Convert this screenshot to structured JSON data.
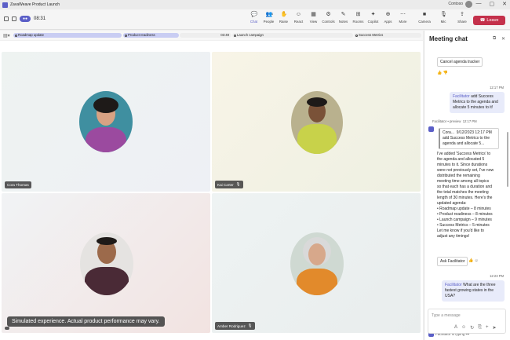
{
  "window": {
    "title": "ZavaWeave Product Launch",
    "org": "Contoso",
    "min": "—",
    "max": "▢",
    "close": "✕"
  },
  "toolbar": {
    "badge": "●●",
    "timer": "08:31",
    "tools": [
      {
        "key": "chat",
        "label": "Chat",
        "icon": "chat-icon",
        "glyph": "💬"
      },
      {
        "key": "people",
        "label": "People",
        "icon": "people-icon",
        "glyph": "👥",
        "count": "4"
      },
      {
        "key": "raise",
        "label": "Raise",
        "icon": "hand-icon",
        "glyph": "✋"
      },
      {
        "key": "react",
        "label": "React",
        "icon": "smile-icon",
        "glyph": "☺"
      },
      {
        "key": "view",
        "label": "View",
        "icon": "grid-icon",
        "glyph": "▦"
      },
      {
        "key": "controls",
        "label": "Controls",
        "icon": "controls-icon",
        "glyph": "⚙"
      },
      {
        "key": "notes",
        "label": "Notes",
        "icon": "notes-icon",
        "glyph": "✎"
      },
      {
        "key": "rooms",
        "label": "Rooms",
        "icon": "rooms-icon",
        "glyph": "⊞"
      },
      {
        "key": "copilot",
        "label": "Copilot",
        "icon": "copilot-icon",
        "glyph": "✦"
      },
      {
        "key": "apps",
        "label": "Apps",
        "icon": "apps-icon",
        "glyph": "⊕"
      },
      {
        "key": "more",
        "label": "More",
        "icon": "more-icon",
        "glyph": "⋯"
      }
    ],
    "camera": "Camera",
    "mic": "Mic",
    "share": "Share",
    "leave": "Leave"
  },
  "agenda": {
    "segments": [
      {
        "label": "Roadmap update",
        "remaining": "",
        "color": "#c9cdf3"
      },
      {
        "label": "Product readiness",
        "remaining": "",
        "color": "#c9cdf3"
      },
      {
        "label": "",
        "remaining": "03:49",
        "color": "#eeeeee"
      },
      {
        "label": "Launch campaign",
        "remaining": "",
        "color": "#eeeeee"
      },
      {
        "label": "Success Metrics",
        "remaining": "",
        "color": "#eeeeee"
      }
    ]
  },
  "participants": [
    {
      "name": "Cora Thomas",
      "muted": false
    },
    {
      "name": "Kai Carter",
      "muted": true
    },
    {
      "name": "",
      "muted": false
    },
    {
      "name": "Amber Rodriguez",
      "muted": true
    }
  ],
  "toast": "Simulated experience. Actual product performance may vary.",
  "chat": {
    "title": "Meeting chat",
    "cancel_button": "Cancel agenda tracker",
    "msg1": {
      "time": "12:17 PM",
      "mention": "Facilitator",
      "text": " add Success Metrics to the agenda and allocate 5 minutes to it!"
    },
    "reply": {
      "author": "Facilitator",
      "tag": "preview",
      "time": "12:17 PM",
      "quote_head": "Cora...",
      "quote_time": "9/12/2023 12:17 PM",
      "quote_text": "add Success Metrics to the agenda and allocate 5...",
      "lines": [
        "I've added 'Success Metrics' to",
        "the agenda and allocated 5",
        "minutes to it. Since durations",
        "were not previously set, I've now",
        "distributed the remaining",
        "meeting time among all topics",
        "so that each has a duration and",
        "the total matches the meeting",
        "length of 30 minutes. Here's the",
        "updated agenda:",
        "• Roadmap update – 8 minutes",
        "• Product readiness – 8 minutes",
        "• Launch campaign – 9 minutes",
        "• Success Metrics – 5 minutes",
        "Let me know if you'd like to",
        "adjust any timings!"
      ],
      "ask_button": "Ask Facilitator"
    },
    "msg2": {
      "time": "12:23 PM",
      "mention": "Facilitator",
      "text": " What are the three fastest growing states in the USA?"
    },
    "typing": "Facilitator is typing",
    "placeholder": "Type a message"
  }
}
